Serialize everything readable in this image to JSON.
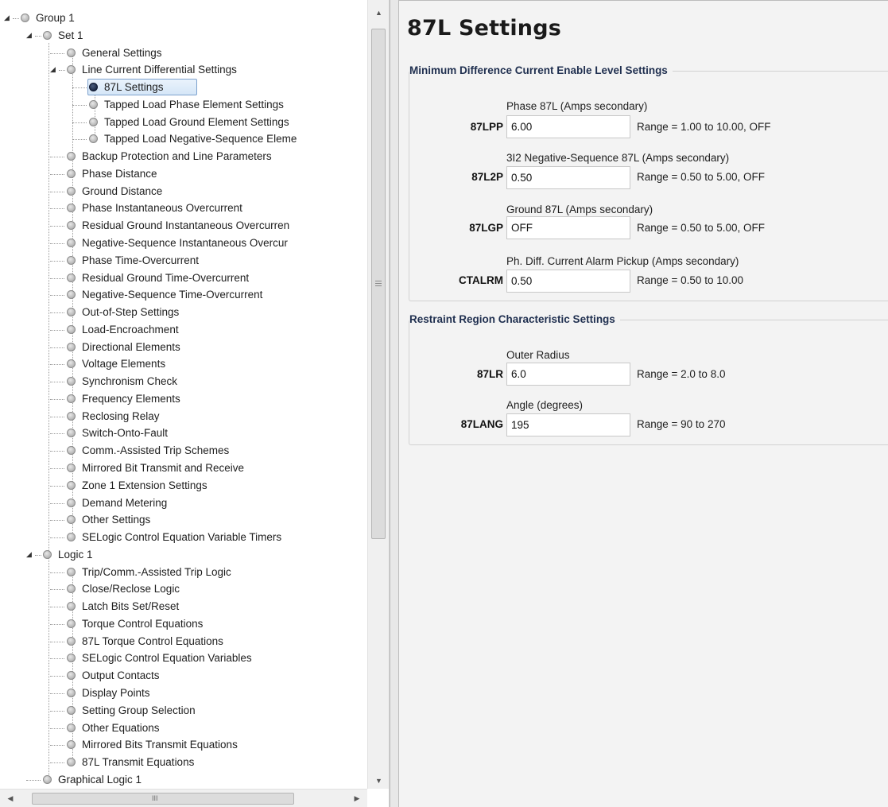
{
  "tree": {
    "items": [
      {
        "label": "Group 1"
      },
      {
        "label": "Set 1"
      },
      {
        "label": "General Settings"
      },
      {
        "label": "Line Current Differential Settings"
      },
      {
        "label": "87L Settings"
      },
      {
        "label": "Tapped Load Phase Element Settings"
      },
      {
        "label": "Tapped Load Ground Element Settings"
      },
      {
        "label": "Tapped Load Negative-Sequence Eleme"
      },
      {
        "label": "Backup Protection and Line Parameters"
      },
      {
        "label": "Phase Distance"
      },
      {
        "label": "Ground Distance"
      },
      {
        "label": "Phase Instantaneous Overcurrent"
      },
      {
        "label": "Residual Ground Instantaneous Overcurren"
      },
      {
        "label": "Negative-Sequence Instantaneous Overcur"
      },
      {
        "label": "Phase Time-Overcurrent"
      },
      {
        "label": "Residual Ground Time-Overcurrent"
      },
      {
        "label": "Negative-Sequence Time-Overcurrent"
      },
      {
        "label": "Out-of-Step Settings"
      },
      {
        "label": "Load-Encroachment"
      },
      {
        "label": "Directional Elements"
      },
      {
        "label": "Voltage Elements"
      },
      {
        "label": "Synchronism Check"
      },
      {
        "label": "Frequency Elements"
      },
      {
        "label": "Reclosing Relay"
      },
      {
        "label": "Switch-Onto-Fault"
      },
      {
        "label": "Comm.-Assisted Trip Schemes"
      },
      {
        "label": "Mirrored Bit Transmit and Receive"
      },
      {
        "label": "Zone 1 Extension Settings"
      },
      {
        "label": "Demand Metering"
      },
      {
        "label": "Other Settings"
      },
      {
        "label": "SELogic Control Equation Variable Timers"
      },
      {
        "label": "Logic 1"
      },
      {
        "label": "Trip/Comm.-Assisted Trip Logic"
      },
      {
        "label": "Close/Reclose Logic"
      },
      {
        "label": "Latch Bits Set/Reset"
      },
      {
        "label": "Torque Control Equations"
      },
      {
        "label": "87L Torque Control Equations"
      },
      {
        "label": "SELogic Control Equation Variables"
      },
      {
        "label": "Output Contacts"
      },
      {
        "label": "Display Points"
      },
      {
        "label": "Setting Group Selection"
      },
      {
        "label": "Other Equations"
      },
      {
        "label": "Mirrored Bits Transmit Equations"
      },
      {
        "label": "87L Transmit Equations"
      },
      {
        "label": "Graphical Logic 1"
      }
    ],
    "selected": "87L Settings"
  },
  "settings": {
    "title": "87L Settings",
    "groups": [
      {
        "title": "Minimum Difference Current Enable Level Settings",
        "fields": [
          {
            "caption": "Phase 87L (Amps secondary)",
            "name": "87LPP",
            "value": "6.00",
            "range": "Range = 1.00 to 10.00, OFF"
          },
          {
            "caption": "3I2 Negative-Sequence 87L (Amps secondary)",
            "name": "87L2P",
            "value": "0.50",
            "range": "Range = 0.50 to 5.00, OFF"
          },
          {
            "caption": "Ground 87L (Amps secondary)",
            "name": "87LGP",
            "value": "OFF",
            "range": "Range = 0.50 to 5.00, OFF"
          },
          {
            "caption": "Ph. Diff. Current Alarm Pickup (Amps secondary)",
            "name": "CTALRM",
            "value": "0.50",
            "range": "Range = 0.50 to 10.00"
          }
        ]
      },
      {
        "title": "Restraint Region Characteristic Settings",
        "fields": [
          {
            "caption": "Outer Radius",
            "name": "87LR",
            "value": "6.0",
            "range": "Range = 2.0 to 8.0"
          },
          {
            "caption": "Angle (degrees)",
            "name": "87LANG",
            "value": "195",
            "range": "Range = 90 to 270"
          }
        ]
      }
    ]
  },
  "scrollbars": {
    "up_arrow": "▲",
    "down_arrow": "▼",
    "left_arrow": "◀",
    "right_arrow": "▶",
    "grip": "III"
  }
}
